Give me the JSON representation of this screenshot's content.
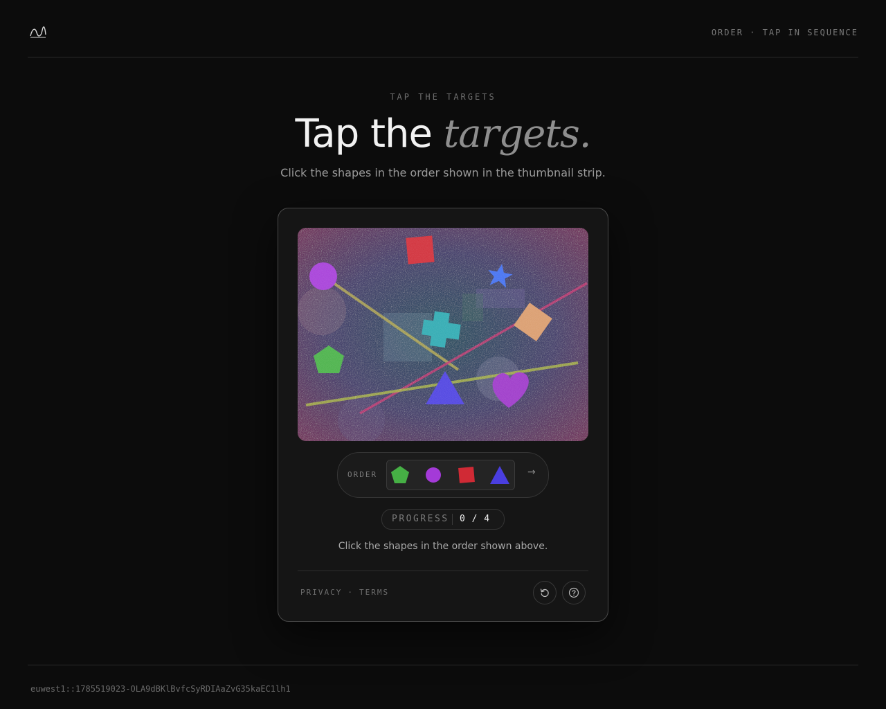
{
  "header": {
    "logo_icon": "wave-logo-icon",
    "meta": "ORDER · TAP IN SEQUENCE"
  },
  "hero": {
    "eyebrow": "TAP THE TARGETS",
    "title_main": "Tap the ",
    "title_accent": "targets.",
    "subtitle": "Click the shapes in the order shown in the thumbnail strip."
  },
  "challenge": {
    "canvas_shapes": [
      {
        "name": "red-square-shape",
        "color": "#d02a35"
      },
      {
        "name": "purple-circle-shape",
        "color": "#a43ad8"
      },
      {
        "name": "blue-star-shape",
        "color": "#3f6df0"
      },
      {
        "name": "cyan-cross-shape",
        "color": "#2aa8b0"
      },
      {
        "name": "orange-diamond-shape",
        "color": "#d99a6a"
      },
      {
        "name": "green-pentagon-shape",
        "color": "#46b045"
      },
      {
        "name": "blue-triangle-shape",
        "color": "#4a3ee0"
      },
      {
        "name": "purple-heart-shape",
        "color": "#9b34c8"
      }
    ],
    "order_label": "ORDER",
    "order_sequence": [
      {
        "name": "green-pentagon",
        "color": "#46b045"
      },
      {
        "name": "purple-circle",
        "color": "#a43ad8"
      },
      {
        "name": "red-square",
        "color": "#d02a35"
      },
      {
        "name": "blue-triangle",
        "color": "#4a3ee0"
      }
    ],
    "arrow": "→",
    "progress_label": "PROGRESS",
    "progress_value": "0 / 4",
    "instruction": "Click the shapes in the order shown above."
  },
  "card_footer": {
    "privacy": "PRIVACY",
    "separator": "·",
    "terms": "TERMS",
    "reload_icon": "reload-icon",
    "help_icon": "help-icon"
  },
  "footer": {
    "session_id": "euwest1::1785519023-OLA9dBKlBvfcSyRDIAaZvG35kaEC1lh1"
  }
}
